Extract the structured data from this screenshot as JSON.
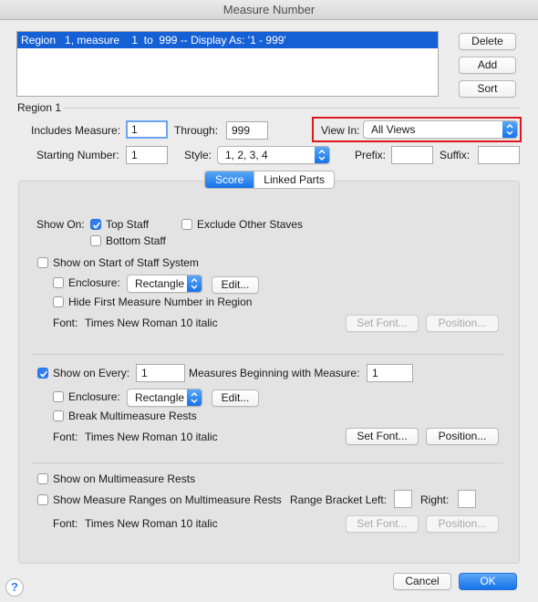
{
  "window": {
    "title": "Measure Number"
  },
  "regions_list": {
    "rows": [
      "Region   1, measure    1  to  999 -- Display As: '1 - 999'"
    ]
  },
  "buttons": {
    "delete": "Delete",
    "add": "Add",
    "sort": "Sort",
    "cancel": "Cancel",
    "ok": "OK"
  },
  "region": {
    "heading": "Region 1",
    "includes_measure_label": "Includes Measure:",
    "includes_measure_value": "1",
    "through_label": "Through:",
    "through_value": "999",
    "view_in_label": "View In:",
    "view_in_value": "All Views",
    "starting_number_label": "Starting Number:",
    "starting_number_value": "1",
    "style_label": "Style:",
    "style_value": "1, 2, 3, 4",
    "prefix_label": "Prefix:",
    "prefix_value": "",
    "suffix_label": "Suffix:",
    "suffix_value": ""
  },
  "tabs": {
    "score": "Score",
    "linked_parts": "Linked Parts"
  },
  "show_on": {
    "label": "Show On:",
    "top_staff": "Top Staff",
    "top_staff_checked": true,
    "exclude_other_staves": "Exclude Other Staves",
    "bottom_staff": "Bottom Staff"
  },
  "start_system": {
    "label": "Show on Start of Staff System",
    "enclosure_label": "Enclosure:",
    "enclosure_value": "Rectangle",
    "edit": "Edit...",
    "hide_first": "Hide First Measure Number in Region",
    "font_label": "Font:",
    "font_value": "Times New Roman 10  italic",
    "set_font": "Set Font...",
    "position": "Position..."
  },
  "every": {
    "label": "Show on Every:",
    "value": "1",
    "beginning_label": "Measures Beginning with Measure:",
    "beginning_value": "1",
    "enclosure_label": "Enclosure:",
    "enclosure_value": "Rectangle",
    "edit": "Edit...",
    "break_rests": "Break Multimeasure Rests",
    "font_label": "Font:",
    "font_value": "Times New Roman 10  italic",
    "set_font": "Set Font...",
    "position": "Position..."
  },
  "multimeasure": {
    "show_on_rests": "Show on Multimeasure Rests",
    "show_ranges": "Show Measure Ranges on Multimeasure Rests",
    "bracket_left_label": "Range Bracket Left:",
    "bracket_left_value": "",
    "right_label": "Right:",
    "right_value": "",
    "font_label": "Font:",
    "font_value": "Times New Roman 10  italic",
    "set_font": "Set Font...",
    "position": "Position..."
  },
  "help": {
    "glyph": "?"
  },
  "colors": {
    "accent": "#1573ea",
    "highlight_box": "#e0161c",
    "selection": "#1660d6"
  }
}
